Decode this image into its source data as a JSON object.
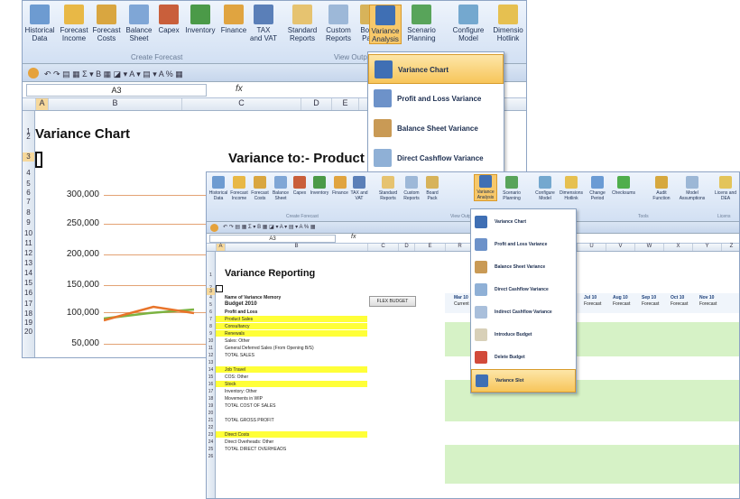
{
  "ribbon1": {
    "buttons": [
      "Historical Data",
      "Forecast Income",
      "Forecast Costs",
      "Balance Sheet",
      "Capex",
      "Inventory",
      "Finance",
      "TAX and VAT",
      "Standard Reports",
      "Custom Reports",
      "Board Pack",
      "Variance Analysis",
      "Scenario Planning",
      "Configure Model",
      "Dimensio Hotlink"
    ],
    "groups": [
      "Create Forecast",
      "View Outp"
    ]
  },
  "ribbon2": {
    "buttons": [
      "Historical Data",
      "Forecast Income",
      "Forecast Costs",
      "Balance Sheet",
      "Capex",
      "Inventory",
      "Finance",
      "TAX and VAT",
      "Standard Reports",
      "Custom Reports",
      "Board Pack",
      "Variance Analysis",
      "Scenario Planning",
      "Configure Model",
      "Dimensions Hotlink",
      "Change Period",
      "Checksums",
      "Audit Function",
      "Model Assumptions",
      "Licens and DEA"
    ],
    "groups": [
      "Create Forecast",
      "View Outp",
      "Tools",
      "Licens"
    ]
  },
  "sheet1": {
    "cell_ref": "A3",
    "fx": "fx",
    "cols": [
      "A",
      "B",
      "C",
      "D",
      "E",
      "F"
    ],
    "rows": [
      "1",
      "2",
      "3",
      "4",
      "5",
      "6",
      "7",
      "8",
      "9",
      "10",
      "11",
      "12",
      "13",
      "14",
      "15",
      "16",
      "17",
      "18",
      "19",
      "20"
    ],
    "title": "Variance Chart",
    "chart_title": "Variance to:- Product",
    "y_ticks": [
      "300,000",
      "250,000",
      "200,000",
      "150,000",
      "100,000",
      "50,000"
    ]
  },
  "menu1": {
    "items": [
      "Variance Chart",
      "Profit and Loss Variance",
      "Balance Sheet Variance",
      "Direct Cashflow Variance"
    ]
  },
  "menu2": {
    "items": [
      "Variance Chart",
      "Profit and Loss Variance",
      "Balance Sheet Variance",
      "Direct Cashflow Variance",
      "Indirect Cashflow Variance",
      "Introduce Budget",
      "Delete Budget",
      "Variance Slot"
    ]
  },
  "sheet2": {
    "cell_ref": "A3",
    "fx": "fx",
    "cols": [
      "A",
      "B",
      "C",
      "D",
      "E",
      "R",
      "U",
      "V",
      "W",
      "X",
      "Y",
      "Z"
    ],
    "title": "Variance Reporting",
    "memory_label": "Name of Variance Memory",
    "memory_value": "Budget 2010",
    "flex_button": "FLEX BUDGET",
    "months": [
      "Mar 10",
      "Jul 10",
      "Aug 10",
      "Sep 10",
      "Oct 10",
      "Nov 10"
    ],
    "month_sub": [
      "Current",
      "Forecast",
      "Forecast",
      "Forecast",
      "Forecast",
      "Forecast"
    ],
    "rows": [
      {
        "n": "5",
        "label": "Budget 2010"
      },
      {
        "n": "6",
        "label": "Profit and Loss"
      },
      {
        "n": "7",
        "label": "Product Sales"
      },
      {
        "n": "8",
        "label": "Consultancy"
      },
      {
        "n": "9",
        "label": "Renewals"
      },
      {
        "n": "10",
        "label": "Sales: Other"
      },
      {
        "n": "11",
        "label": "General Deferred Sales (From Opening B/S)"
      },
      {
        "n": "12",
        "label": "TOTAL SALES"
      },
      {
        "n": "13",
        "label": ""
      },
      {
        "n": "14",
        "label": "Job Travel"
      },
      {
        "n": "15",
        "label": "COS: Other"
      },
      {
        "n": "16",
        "label": "Stock"
      },
      {
        "n": "17",
        "label": "Inventory: Other"
      },
      {
        "n": "18",
        "label": "Movements in WIP"
      },
      {
        "n": "19",
        "label": "TOTAL COST OF SALES"
      },
      {
        "n": "20",
        "label": ""
      },
      {
        "n": "21",
        "label": "TOTAL GROSS PROFIT"
      },
      {
        "n": "22",
        "label": ""
      },
      {
        "n": "23",
        "label": "Direct Costs"
      },
      {
        "n": "24",
        "label": "Direct Overheads: Other"
      },
      {
        "n": "25",
        "label": "TOTAL DIRECT OVERHEADS"
      },
      {
        "n": "26",
        "label": ""
      }
    ]
  }
}
